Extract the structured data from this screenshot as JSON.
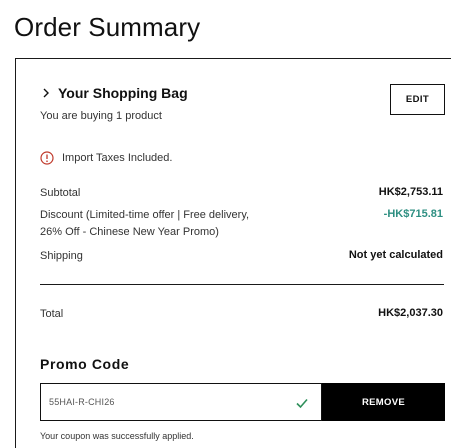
{
  "page": {
    "title": "Order Summary"
  },
  "bag": {
    "title": "Your Shopping Bag",
    "subtitle": "You are buying 1 product",
    "edit_label": "EDIT"
  },
  "tax": {
    "text": "Import Taxes Included."
  },
  "lines": {
    "subtotal_label": "Subtotal",
    "subtotal_value": "HK$2,753.11",
    "discount_label_1": "Discount (Limited-time offer | Free delivery,",
    "discount_label_2": "26% Off - Chinese New Year Promo)",
    "discount_value": "-HK$715.81",
    "shipping_label": "Shipping",
    "shipping_value": "Not yet calculated",
    "total_label": "Total",
    "total_value": "HK$2,037.30"
  },
  "promo": {
    "title": "Promo Code",
    "code_value": "55HAI-R-CHI26",
    "remove_label": "REMOVE",
    "success_message": "Your coupon was successfully applied."
  },
  "colors": {
    "discount": "#2e8f82",
    "check": "#2e8f5a",
    "alert": "#c0392b"
  }
}
